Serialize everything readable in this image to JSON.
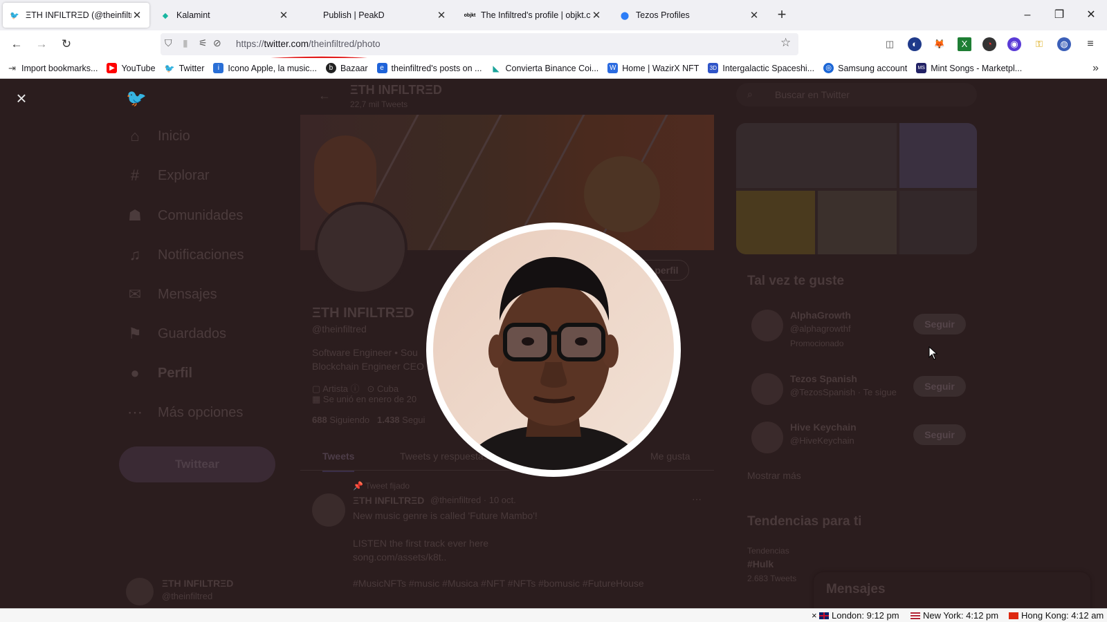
{
  "browser": {
    "tabs": [
      {
        "title": "ΞTH INFILTRΞD (@theinfiltred) /",
        "icon": "twitter-bird-icon",
        "active": true
      },
      {
        "title": "Kalamint",
        "icon": "kalamint-drop-icon",
        "active": false
      },
      {
        "title": "Publish | PeakD",
        "icon": "peakd-icon",
        "active": false
      },
      {
        "title": "The Infiltred's profile | objkt.com",
        "icon": "objkt-icon",
        "active": false
      },
      {
        "title": "Tezos Profiles",
        "icon": "tezos-profiles-icon",
        "active": false
      }
    ],
    "new_tab_glyph": "+",
    "window_controls": {
      "minimize": "–",
      "restore": "❐",
      "close": "✕"
    },
    "url": {
      "prefix": "https://",
      "domain": "twitter.com",
      "path": "/theinfiltred/photo"
    },
    "bookmarks": [
      {
        "label": "Import bookmarks...",
        "icon": "import-icon",
        "color": "#444444"
      },
      {
        "label": "YouTube",
        "icon": "youtube-icon",
        "color": "#ff0000"
      },
      {
        "label": "Twitter",
        "icon": "twitter-bird-icon",
        "color": "#1d9bf0"
      },
      {
        "label": "Icono Apple, la music...",
        "icon": "icono-icon",
        "color": "#2a6fd6"
      },
      {
        "label": "Bazaar",
        "icon": "bazaar-icon",
        "color": "#222222"
      },
      {
        "label": "theinfiltred's posts on ...",
        "icon": "hive-posts-icon",
        "color": "#1f63d8"
      },
      {
        "label": "Convierta Binance Coi...",
        "icon": "binance-icon",
        "color": "#1aa39a"
      },
      {
        "label": "Home | WazirX NFT",
        "icon": "wazirx-icon",
        "color": "#2b6be0"
      },
      {
        "label": "Intergalactic Spaceshi...",
        "icon": "3d-icon",
        "color": "#3055c8"
      },
      {
        "label": "Samsung account",
        "icon": "samsung-icon",
        "color": "#1b66d6"
      },
      {
        "label": "Mint Songs - Marketpl...",
        "icon": "mintsongs-icon",
        "color": "#222266"
      }
    ]
  },
  "page": {
    "sidebar": [
      {
        "label": "Inicio",
        "icon": "home-icon"
      },
      {
        "label": "Explorar",
        "icon": "hashtag-icon"
      },
      {
        "label": "Comunidades",
        "icon": "communities-icon"
      },
      {
        "label": "Notificaciones",
        "icon": "bell-icon"
      },
      {
        "label": "Mensajes",
        "icon": "mail-icon"
      },
      {
        "label": "Guardados",
        "icon": "bookmark-icon"
      },
      {
        "label": "Perfil",
        "icon": "person-icon"
      },
      {
        "label": "Más opciones",
        "icon": "more-icon"
      }
    ],
    "tweet_button": "Twittear",
    "header_name": "ΞTH INFILTRΞD",
    "header_count": "22,7 mil Tweets",
    "profile": {
      "name": "ΞTH INFILTRΞD",
      "handle": "@theinfiltred",
      "bio_1": "Software Engineer • Sou",
      "bio_2": "Blockchain Engineer CEO",
      "meta_1": "Artista",
      "meta_2": "Cuba",
      "joined": "Se unió en enero de 20",
      "following_count": "688",
      "following_label": "Siguiendo",
      "followers_count": "1.438",
      "followers_label": "Segui",
      "edit_profile": "r perfil"
    },
    "profile_tabs": [
      "Tweets",
      "Tweets y respuestas",
      "Me gusta"
    ],
    "pinned": {
      "label": "Tweet fijado",
      "author": "ΞTH INFILTRΞD",
      "meta": "@theinfiltred · 10 oct.",
      "line1": "New music genre is called 'Future Mambo'!",
      "line2": "LISTEN the first track ever here",
      "link": "song.com/assets/k8t..",
      "tags": "#MusicNFTs #music #Musica #NFT #NFTs #bomusic #FutureHouse"
    },
    "account_switcher": {
      "name": "ΞTH INFILTRΞD",
      "handle": "@theinfiltred"
    },
    "search_placeholder": "Buscar en Twitter",
    "suggestions_title": "Tal vez te guste",
    "suggestions": [
      {
        "name": "AlphaGrowth",
        "handle": "@alphagrowthf",
        "note": "Promocionado",
        "button": "Seguir"
      },
      {
        "name": "Tezos Spanish",
        "handle": "@TezosSpanish · Te sigue",
        "note": "",
        "button": "Seguir"
      },
      {
        "name": "Hive Keychain",
        "handle": "@HiveKeychain",
        "note": "",
        "button": "Seguir"
      }
    ],
    "show_more": "Mostrar más",
    "trends_title": "Tendencias para ti",
    "trend": {
      "context": "Tendencias",
      "name": "#Hulk",
      "count": "2.683 Tweets"
    },
    "messages_label": "Mensajes"
  },
  "modal": {
    "close_glyph": "×"
  },
  "status_clocks": [
    {
      "label": "London: 9:12 pm",
      "flag": "uk"
    },
    {
      "label": "New York: 4:12 pm",
      "flag": "us"
    },
    {
      "label": "Hong Kong: 4:12 am",
      "flag": "hk"
    }
  ],
  "status_close": "×"
}
